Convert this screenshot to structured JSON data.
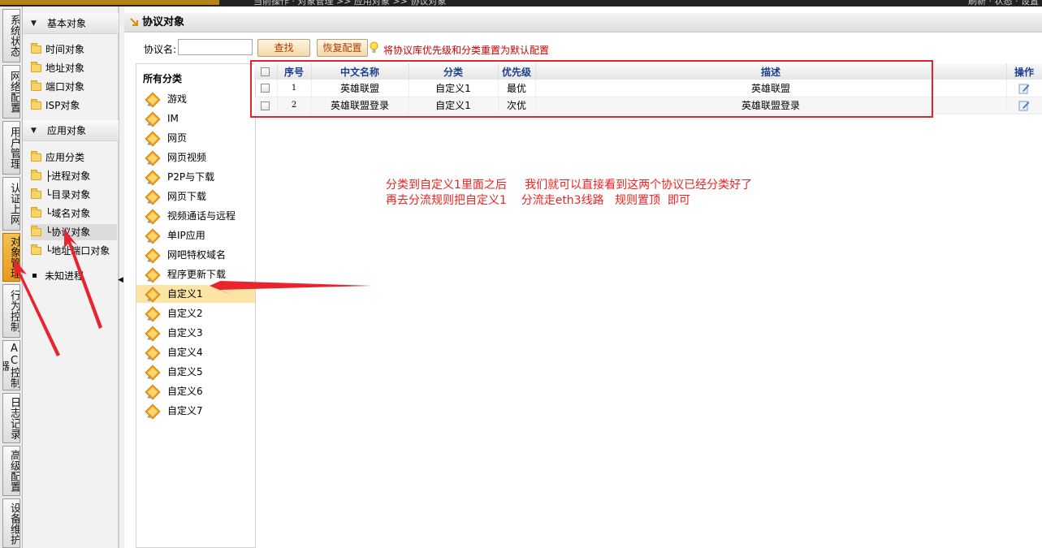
{
  "topbar": {
    "breadcrumb": "当前操作 · 对象管理 >> 应用对象 >> 协议对象",
    "right_text": "刷新 · 状态 · 设置"
  },
  "vtabs": [
    {
      "label": "系统状态",
      "active": false
    },
    {
      "label": "网络配置",
      "active": false
    },
    {
      "label": "用户管理",
      "active": false
    },
    {
      "label": "认证上网",
      "active": false
    },
    {
      "label": "对象管理",
      "active": true
    },
    {
      "label": "行为控制",
      "active": false
    },
    {
      "label": "AC控制器",
      "active": false
    },
    {
      "label": "日志记录",
      "active": false
    },
    {
      "label": "高级配置",
      "active": false
    },
    {
      "label": "设备维护",
      "active": false
    }
  ],
  "tree": {
    "basic_group": "基本对象",
    "basic_items": [
      "时间对象",
      "地址对象",
      "端口对象",
      "ISP对象"
    ],
    "app_group": "应用对象",
    "app_items": [
      "应用分类",
      "├进程对象",
      "└目录对象",
      "└域名对象",
      "└协议对象",
      "└地址端口对象"
    ],
    "selected_item": "└协议对象",
    "unknown": "未知进程"
  },
  "page": {
    "title": "协议对象",
    "search_label": "协议名:",
    "search_value": "",
    "find_button": "查找",
    "restore_button": "恢复配置",
    "hint": "将协议库优先级和分类重置为默认配置"
  },
  "categories": {
    "header": "所有分类",
    "items": [
      "游戏",
      "IM",
      "网页",
      "网页视频",
      "P2P与下载",
      "网页下载",
      "视频通话与远程",
      "单IP应用",
      "网吧特权域名",
      "程序更新下载",
      "自定义1",
      "自定义2",
      "自定义3",
      "自定义4",
      "自定义5",
      "自定义6",
      "自定义7"
    ],
    "selected": "自定义1"
  },
  "grid": {
    "columns": [
      "序号",
      "中文名称",
      "分类",
      "优先级",
      "描述",
      "操作"
    ],
    "rows": [
      {
        "index": "1",
        "name": "英雄联盟",
        "category": "自定义1",
        "priority": "最优",
        "description": "英雄联盟"
      },
      {
        "index": "2",
        "name": "英雄联盟登录",
        "category": "自定义1",
        "priority": "次优",
        "description": "英雄联盟登录"
      }
    ]
  },
  "annotation": {
    "line1": "分类到自定义1里面之后     我们就可以直接看到这两个协议已经分类好了",
    "line2": "再去分流规则把自定义1    分流走eth3线路   规则置顶  即可"
  },
  "colors": {
    "annotation_red": "#e22222",
    "accent_orange": "#e79a1b",
    "header_blue": "#1c3f8c"
  }
}
